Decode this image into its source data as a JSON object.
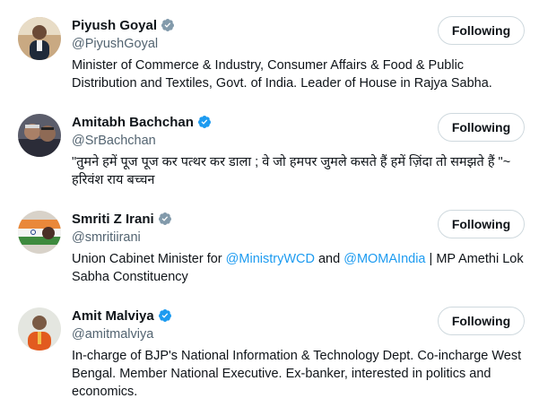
{
  "colors": {
    "verified_gray": "#829aab",
    "verified_blue": "#1d9bf0",
    "mention": "#1d9bf0"
  },
  "users": [
    {
      "name": "Piyush Goyal",
      "handle": "@PiyushGoyal",
      "verified": "gray",
      "button": "Following",
      "bio_parts": [
        "Minister of Commerce & Industry, Consumer Affairs & Food & Public Distribution and Textiles, Govt. of India. Leader of House in Rajya Sabha."
      ]
    },
    {
      "name": "Amitabh Bachchan",
      "handle": "@SrBachchan",
      "verified": "blue",
      "button": "Following",
      "bio_parts": [
        "\"तुमने हमें पूज पूज कर पत्थर कर डाला ; वे जो हमपर जुमले कसते हैं हमें ज़िंदा तो समझते हैं \"~ हरिवंश राय बच्चन"
      ]
    },
    {
      "name": "Smriti Z Irani",
      "handle": "@smritiirani",
      "verified": "gray",
      "button": "Following",
      "bio_parts": [
        "Union Cabinet Minister for ",
        "@MinistryWCD",
        " and ",
        "@MOMAIndia",
        " | MP Amethi Lok Sabha Constituency"
      ]
    },
    {
      "name": "Amit Malviya",
      "handle": "@amitmalviya",
      "verified": "blue",
      "button": "Following",
      "bio_parts": [
        "In-charge of BJP's National Information & Technology Dept. Co-incharge West Bengal. Member National Executive. Ex-banker, interested in politics and economics."
      ]
    }
  ]
}
